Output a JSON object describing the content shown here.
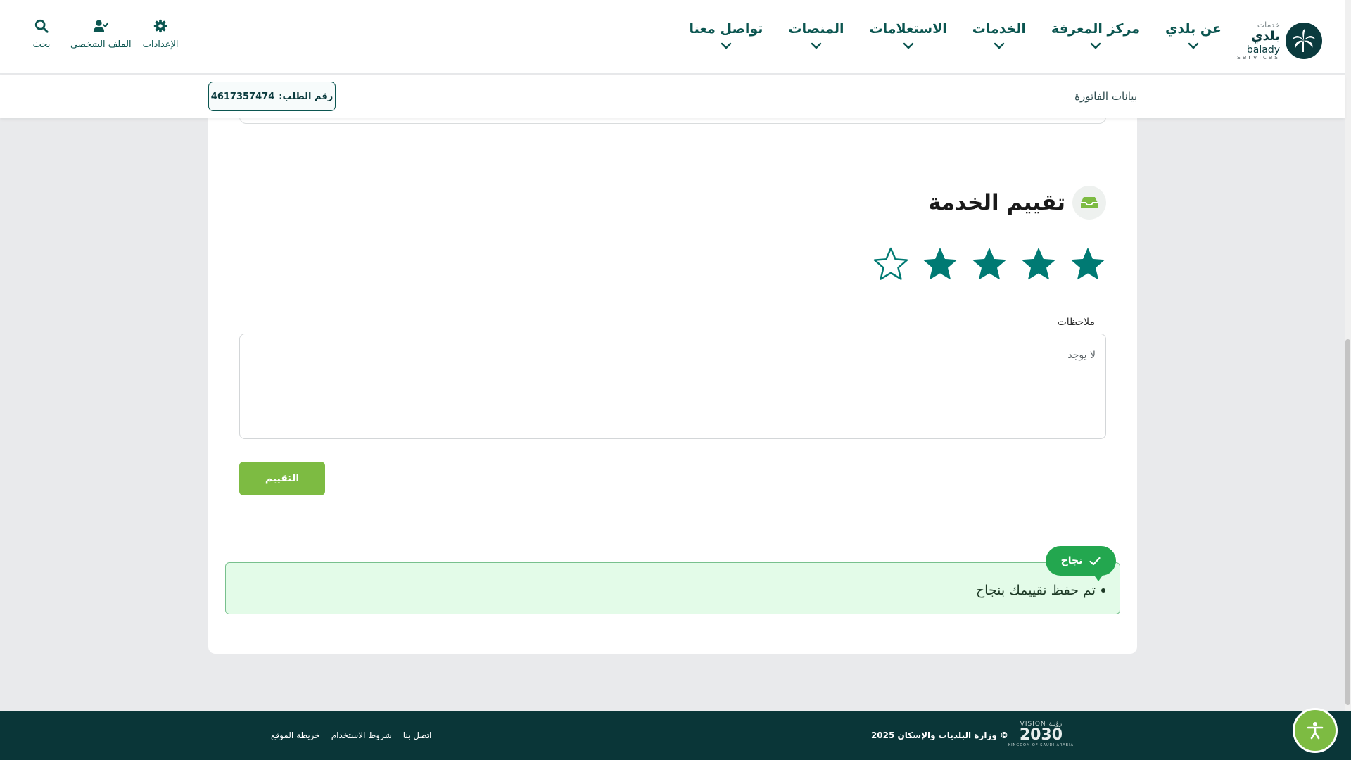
{
  "header": {
    "logo": {
      "ar_small": "خدمات",
      "ar_big": "بلدي",
      "en_big": "balady",
      "en_small": "services"
    },
    "nav": [
      {
        "label": "عن بلدي"
      },
      {
        "label": "مركز المعرفة"
      },
      {
        "label": "الخدمات"
      },
      {
        "label": "الاستعلامات"
      },
      {
        "label": "المنصات"
      },
      {
        "label": "تواصل معنا"
      }
    ],
    "tools": [
      {
        "label": "بحث",
        "icon": "search-icon"
      },
      {
        "label": "الملف الشخصي",
        "icon": "user-check-icon"
      },
      {
        "label": "الإعدادات",
        "icon": "gear-icon"
      }
    ]
  },
  "subbar": {
    "title": "بيانات الفاتورة",
    "order_label": "رقم الطلب:",
    "order_number": "4617357474"
  },
  "rating": {
    "title": "تقييم الخدمة",
    "value": 4,
    "max": 5,
    "notes_label": "ملاحظات",
    "notes_value": "لا يوجد",
    "submit_label": "التقييم"
  },
  "alert": {
    "message": "تم حفظ تقييمك بنجاح",
    "toast_label": "نجاح"
  },
  "footer": {
    "vision_top": "VISION رؤيـة",
    "vision_num": "2030",
    "vision_sub": "KINGDOM OF SAUDI ARABIA",
    "copyright": "© وزارة البلديات والإسكان 2025",
    "links": [
      "اتصل بنا",
      "شروط الاستخدام",
      "خريطة الموقع"
    ]
  },
  "colors": {
    "primary": "#0b5550",
    "accent_green": "#7dbb42",
    "success": "#23a74f",
    "star": "#007a73",
    "footer_bg": "#0a3638"
  }
}
